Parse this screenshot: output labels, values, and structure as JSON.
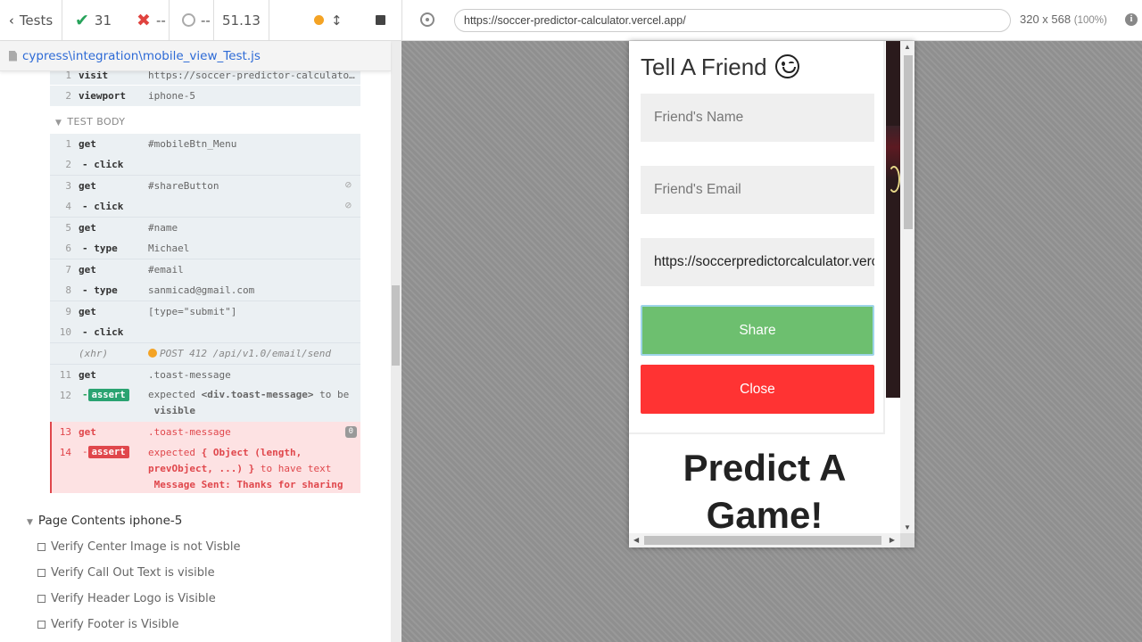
{
  "stats": {
    "tests_label": "Tests",
    "passed": "31",
    "failed": "--",
    "pending": "--",
    "duration": "51.13"
  },
  "spec": {
    "path": "cypress\\integration\\mobile_view_Test.js"
  },
  "before_cmds": [
    {
      "num": "1",
      "name": "visit",
      "msg": "https://soccer-predictor-calculato…"
    },
    {
      "num": "2",
      "name": "viewport",
      "msg": "iphone-5"
    }
  ],
  "test_body_label": "TEST BODY",
  "cmds": [
    {
      "num": "1",
      "name": "get",
      "msg": "#mobileBtn_Menu"
    },
    {
      "num": "2",
      "name": "- click",
      "msg": ""
    },
    {
      "num": "3",
      "name": "get",
      "msg": "#shareButton"
    },
    {
      "num": "4",
      "name": "- click",
      "msg": ""
    },
    {
      "num": "5",
      "name": "get",
      "msg": "#name"
    },
    {
      "num": "6",
      "name": "- type",
      "msg": "Michael"
    },
    {
      "num": "7",
      "name": "get",
      "msg": "#email"
    },
    {
      "num": "8",
      "name": "- type",
      "msg": "sanmicad@gmail.com"
    },
    {
      "num": "9",
      "name": "get",
      "msg": "[type=\"submit\"]"
    },
    {
      "num": "10",
      "name": "- click",
      "msg": ""
    },
    {
      "num": "",
      "name": "(xhr)",
      "msg": "POST 412 /api/v1.0/email/send"
    },
    {
      "num": "11",
      "name": "get",
      "msg": ".toast-message"
    }
  ],
  "assert_pass": {
    "num": "12",
    "dash": "-",
    "badge": "assert",
    "line1_a": "expected ",
    "line1_b": "<div.toast-message>",
    "line1_c": " to be",
    "line2": "visible"
  },
  "assert_fail": {
    "num13": "13",
    "get": "get",
    "sel": ".toast-message",
    "count": "0",
    "num14": "14",
    "dash": "-",
    "badge": "assert",
    "line1_a": "expected ",
    "line1_b": "{ Object (length,",
    "line2": "prevObject, ...) }",
    "line2_b": " to have text",
    "line3": "Message Sent: Thanks for sharing"
  },
  "suite": {
    "title": "Page Contents iphone-5",
    "items": [
      "Verify Center Image is not Visble",
      "Verify Call Out Text is visible",
      "Verify Header Logo is Visible",
      "Verify Footer is Visible"
    ]
  },
  "aut": {
    "url": "https://soccer-predictor-calculator.vercel.app/",
    "size": "320 x 568",
    "zoom": "(100%)"
  },
  "app": {
    "modal_title": "Tell A Friend",
    "name_placeholder": "Friend's Name",
    "email_placeholder": "Friend's Email",
    "link_value": "https://soccerpredictorcalculator.vercel.app",
    "share_label": "Share",
    "close_label": "Close",
    "predict_heading": "Predict A Game!"
  },
  "colors": {
    "pass": "#27a35a",
    "fail": "#e0474c",
    "share": "#6dbf6f",
    "close": "#ff3333",
    "link": "#2d6ad6"
  }
}
